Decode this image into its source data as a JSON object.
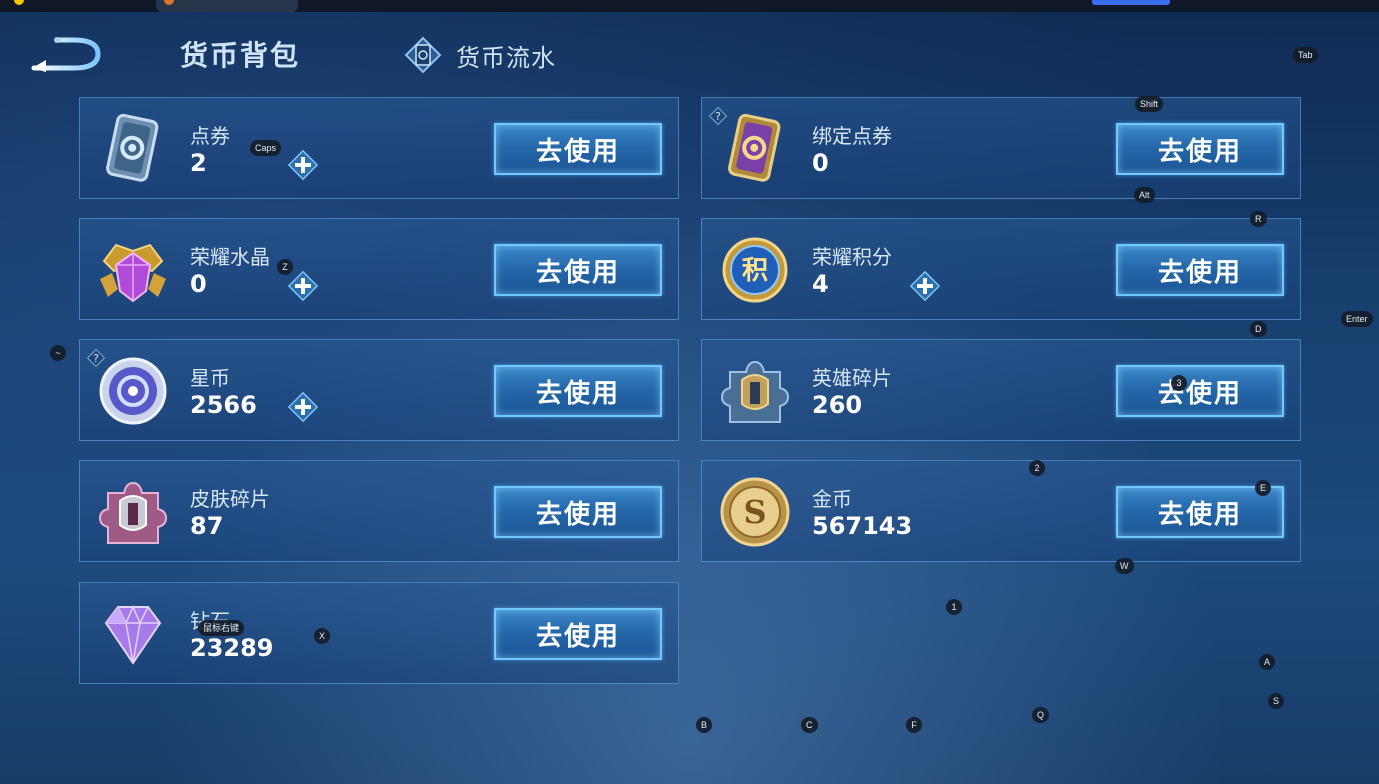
{
  "header": {
    "title_active": "货币背包",
    "tab_flow_label": "货币流水"
  },
  "use_button_label": "去使用",
  "currencies": [
    {
      "name": "点券",
      "amount": "2",
      "icon": "coupon-card-icon"
    },
    {
      "name": "绑定点券",
      "amount": "0",
      "icon": "bound-coupon-card-icon"
    },
    {
      "name": "荣耀水晶",
      "amount": "0",
      "icon": "glory-crystal-icon"
    },
    {
      "name": "荣耀积分",
      "amount": "4",
      "icon": "glory-points-icon"
    },
    {
      "name": "星币",
      "amount": "2566",
      "icon": "star-coin-icon"
    },
    {
      "name": "英雄碎片",
      "amount": "260",
      "icon": "hero-fragment-icon"
    },
    {
      "name": "皮肤碎片",
      "amount": "87",
      "icon": "skin-fragment-icon"
    },
    {
      "name": "金币",
      "amount": "567143",
      "icon": "gold-coin-icon"
    },
    {
      "name": "钻石",
      "amount": "23289",
      "icon": "diamond-icon"
    }
  ],
  "key_hints": [
    "Tab",
    "Shift",
    "Caps",
    "Alt",
    "R",
    "Z",
    "Enter",
    "D",
    "~",
    "3",
    "2",
    "E",
    "W",
    "1",
    "X",
    "鼠标右键",
    "A",
    "S",
    "B",
    "C",
    "F",
    "Q"
  ],
  "colors": {
    "accent": "#6fc8ff",
    "button": "#2366a8",
    "card_border": "#6eaae6",
    "background": "#17406f"
  }
}
